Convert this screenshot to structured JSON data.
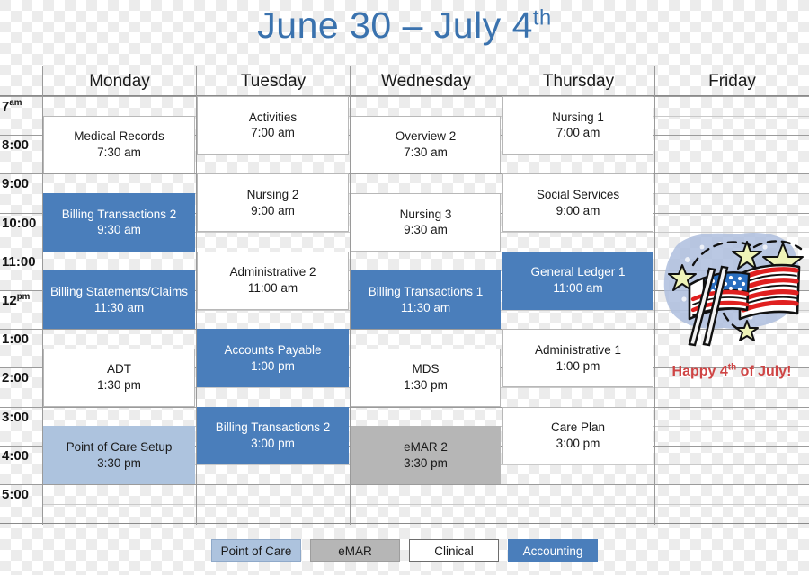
{
  "title": {
    "main": "June 30 – July 4",
    "suffix": "th"
  },
  "calendar": {
    "days": [
      "Monday",
      "Tuesday",
      "Wednesday",
      "Thursday",
      "Friday"
    ],
    "times": [
      {
        "label": "7",
        "suffix": "am"
      },
      {
        "label": "8:00",
        "suffix": ""
      },
      {
        "label": "9:00",
        "suffix": ""
      },
      {
        "label": "10:00",
        "suffix": ""
      },
      {
        "label": "11:00",
        "suffix": ""
      },
      {
        "label": "12",
        "suffix": "pm"
      },
      {
        "label": "1:00",
        "suffix": ""
      },
      {
        "label": "2:00",
        "suffix": ""
      },
      {
        "label": "3:00",
        "suffix": ""
      },
      {
        "label": "4:00",
        "suffix": ""
      },
      {
        "label": "5:00",
        "suffix": ""
      }
    ],
    "events": [
      {
        "day": "Monday",
        "title": "Medical Records",
        "time": "7:30 am",
        "category": "Clinical",
        "start": 7.5,
        "end": 9.0
      },
      {
        "day": "Monday",
        "title": "Billing Transactions 2",
        "time": "9:30  am",
        "category": "Accounting",
        "start": 9.5,
        "end": 11.0
      },
      {
        "day": "Monday",
        "title": "Billing Statements/Claims",
        "time": "11:30 am",
        "category": "Accounting",
        "start": 11.5,
        "end": 13.0
      },
      {
        "day": "Monday",
        "title": "ADT",
        "time": "1:30 pm",
        "category": "Clinical",
        "start": 13.5,
        "end": 15.0
      },
      {
        "day": "Monday",
        "title": "Point of Care Setup",
        "time": "3:30 pm",
        "category": "Point of Care",
        "start": 15.5,
        "end": 17.0
      },
      {
        "day": "Tuesday",
        "title": "Activities",
        "time": "7:00 am",
        "category": "Clinical",
        "start": 7.0,
        "end": 8.5
      },
      {
        "day": "Tuesday",
        "title": "Nursing 2",
        "time": "9:00 am",
        "category": "Clinical",
        "start": 9.0,
        "end": 10.5
      },
      {
        "day": "Tuesday",
        "title": "Administrative 2",
        "time": "11:00 am",
        "category": "Clinical",
        "start": 11.0,
        "end": 12.5
      },
      {
        "day": "Tuesday",
        "title": "Accounts Payable",
        "time": "1:00 pm",
        "category": "Accounting",
        "start": 13.0,
        "end": 14.5
      },
      {
        "day": "Tuesday",
        "title": "Billing Transactions 2",
        "time": "3:00 pm",
        "category": "Accounting",
        "start": 15.0,
        "end": 16.5
      },
      {
        "day": "Wednesday",
        "title": "Overview  2",
        "time": "7:30 am",
        "category": "Clinical",
        "start": 7.5,
        "end": 9.0
      },
      {
        "day": "Wednesday",
        "title": "Nursing 3",
        "time": "9:30 am",
        "category": "Clinical",
        "start": 9.5,
        "end": 11.0
      },
      {
        "day": "Wednesday",
        "title": "Billing Transactions 1",
        "time": "11:30 am",
        "category": "Accounting",
        "start": 11.5,
        "end": 13.0
      },
      {
        "day": "Wednesday",
        "title": "MDS",
        "time": "1:30 pm",
        "category": "Clinical",
        "start": 13.5,
        "end": 15.0
      },
      {
        "day": "Wednesday",
        "title": "eMAR 2",
        "time": "3:30 pm",
        "category": "eMAR",
        "start": 15.5,
        "end": 17.0
      },
      {
        "day": "Thursday",
        "title": "Nursing 1",
        "time": "7:00 am",
        "category": "Clinical",
        "start": 7.0,
        "end": 8.5
      },
      {
        "day": "Thursday",
        "title": "Social Services",
        "time": "9:00 am",
        "category": "Clinical",
        "start": 9.0,
        "end": 10.5
      },
      {
        "day": "Thursday",
        "title": "General Ledger 1",
        "time": "11:00 am",
        "category": "Accounting",
        "start": 11.0,
        "end": 12.5
      },
      {
        "day": "Thursday",
        "title": "Administrative 1",
        "time": "1:00 pm",
        "category": "Clinical",
        "start": 13.0,
        "end": 14.5
      },
      {
        "day": "Thursday",
        "title": "Care Plan",
        "time": "3:00 pm",
        "category": "Clinical",
        "start": 15.0,
        "end": 16.5
      }
    ]
  },
  "friday_art": {
    "greeting_main": "Happy 4",
    "greeting_suffix": "th",
    "greeting_tail": " of July!",
    "icon": "usa-flags-fireworks-clipart"
  },
  "legend": {
    "items": [
      {
        "label": "Point of Care",
        "color": "#adc3de"
      },
      {
        "label": "eMAR",
        "color": "#b6b6b6"
      },
      {
        "label": "Clinical",
        "color": "#ffffff"
      },
      {
        "label": "Accounting",
        "color": "#4a7ebb"
      }
    ]
  },
  "colors": {
    "accent_blue": "#4a7ebb",
    "light_blue": "#adc3de",
    "gray": "#b6b6b6",
    "title_blue": "#3a72ae",
    "greeting_red": "#cf4444"
  }
}
